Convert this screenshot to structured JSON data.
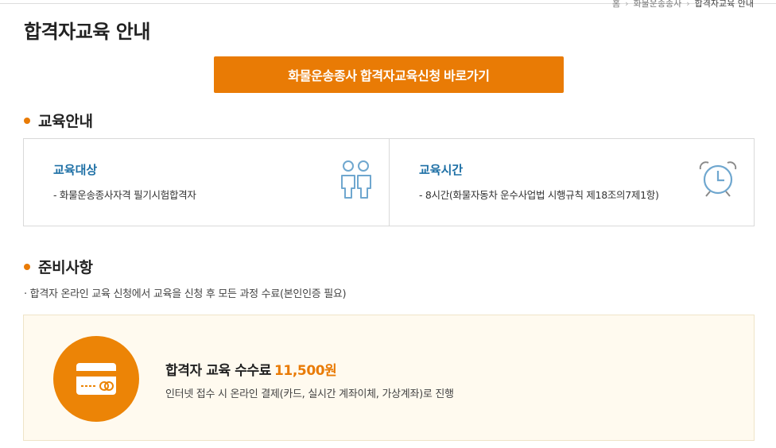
{
  "breadcrumb": {
    "home": "홈",
    "parent": "화물운송종사",
    "current": "합격자교육 안내"
  },
  "page_title": "합격자교육 안내",
  "apply_button": "화물운송종사 합격자교육신청 바로가기",
  "section_education": {
    "heading": "교육안내",
    "target": {
      "label": "교육대상",
      "desc": "- 화물운송종사자격 필기시험합격자",
      "icon": "people-icon"
    },
    "time": {
      "label": "교육시간",
      "desc": "- 8시간(화물자동차 운수사업법 시행규칙 제18조의7제1항)",
      "icon": "alarm-clock-icon"
    }
  },
  "section_prep": {
    "heading": "준비사항",
    "note": "· 합격자 온라인 교육 신청에서 교육을 신청 후 모든 과정 수료(본인인증 필요)",
    "fee": {
      "title": "합격자 교육 수수료",
      "amount": "11,500원",
      "desc": "인터넷 접수 시 온라인 결제(카드, 실시간 계좌이체, 가상계좌)로 진행",
      "icon": "credit-card-icon"
    }
  },
  "colors": {
    "accent": "#e97b05",
    "label_blue": "#1d6fa5",
    "icon_blue": "#6fa7cf",
    "fee_bg": "#fffaef"
  }
}
